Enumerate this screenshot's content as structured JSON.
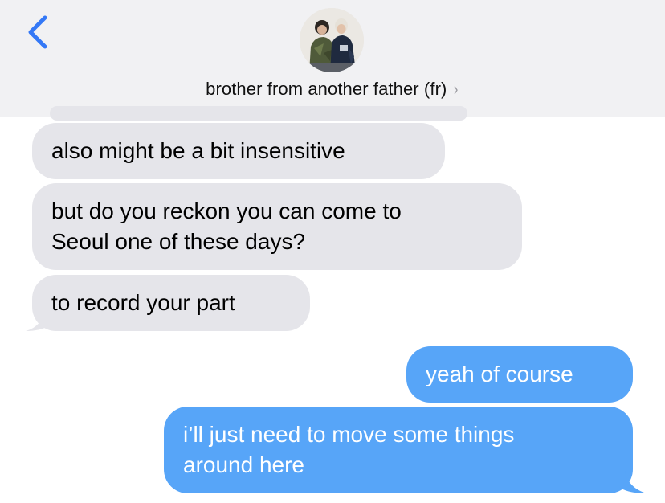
{
  "header": {
    "contact_name": "brother from another father (fr)",
    "chevron": "›",
    "back_icon": "chevron-left-icon",
    "avatar": "contact-photo"
  },
  "colors": {
    "header_bg": "#f1f1f3",
    "received_bubble": "#e5e5ea",
    "sent_bubble": "#57a5f8",
    "accent": "#3478f6"
  },
  "messages": [
    {
      "direction": "received",
      "text": "also might be a bit insensitive"
    },
    {
      "direction": "received",
      "text": "but do you reckon you can come to\nSeoul one of these days?"
    },
    {
      "direction": "received",
      "text": "to record your part"
    },
    {
      "direction": "sent",
      "text": "yeah of course"
    },
    {
      "direction": "sent",
      "text": "i’ll just need to move some things\naround here"
    }
  ]
}
